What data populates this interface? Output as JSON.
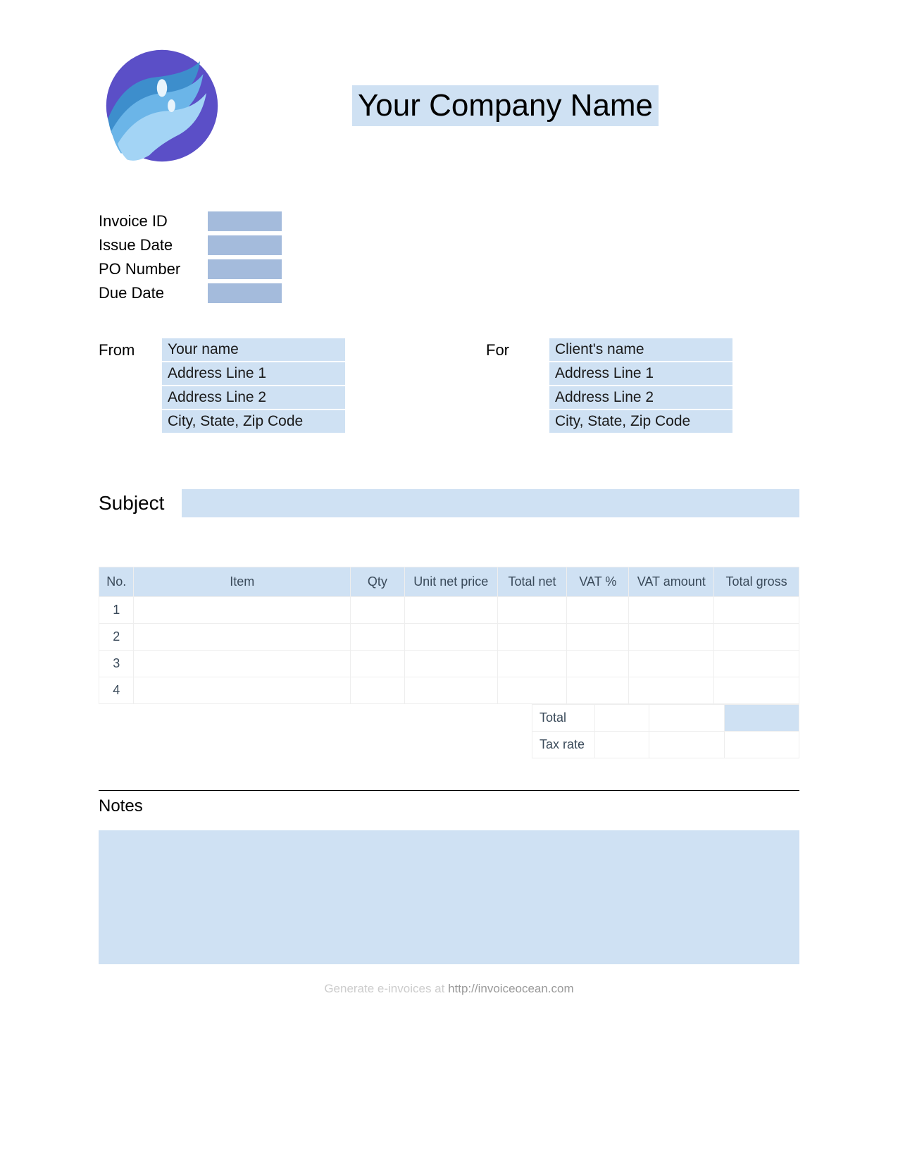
{
  "header": {
    "company_name": "Your Company Name"
  },
  "meta": {
    "invoice_id_label": "Invoice ID",
    "invoice_id": "",
    "issue_date_label": "Issue Date",
    "issue_date": "",
    "po_number_label": "PO Number",
    "po_number": "",
    "due_date_label": "Due Date",
    "due_date": ""
  },
  "from": {
    "label": "From",
    "name": "Your name",
    "address1": "Address Line 1",
    "address2": "Address Line 2",
    "city": "City, State, Zip Code"
  },
  "for": {
    "label": "For",
    "name": "Client's name",
    "address1": "Address Line 1",
    "address2": "Address Line 2",
    "city": "City, State, Zip Code"
  },
  "subject": {
    "label": "Subject",
    "value": ""
  },
  "table": {
    "headers": {
      "no": "No.",
      "item": "Item",
      "qty": "Qty",
      "unit_net_price": "Unit net price",
      "total_net": "Total net",
      "vat_pct": "VAT %",
      "vat_amount": "VAT amount",
      "total_gross": "Total gross"
    },
    "rows": [
      {
        "no": "1",
        "item": "",
        "qty": "",
        "unit_net_price": "",
        "total_net": "",
        "vat_pct": "",
        "vat_amount": "",
        "total_gross": ""
      },
      {
        "no": "2",
        "item": "",
        "qty": "",
        "unit_net_price": "",
        "total_net": "",
        "vat_pct": "",
        "vat_amount": "",
        "total_gross": ""
      },
      {
        "no": "3",
        "item": "",
        "qty": "",
        "unit_net_price": "",
        "total_net": "",
        "vat_pct": "",
        "vat_amount": "",
        "total_gross": ""
      },
      {
        "no": "4",
        "item": "",
        "qty": "",
        "unit_net_price": "",
        "total_net": "",
        "vat_pct": "",
        "vat_amount": "",
        "total_gross": ""
      }
    ],
    "summary": {
      "total_label": "Total",
      "total_vat_pct": "",
      "total_vat_amount": "",
      "total_gross": "",
      "tax_rate_label": "Tax rate",
      "tax_rate_vat_pct": "",
      "tax_rate_vat_amount": "",
      "tax_rate_gross": ""
    }
  },
  "notes": {
    "label": "Notes",
    "value": ""
  },
  "footer": {
    "text": "Generate e-invoices at ",
    "link": "http://invoiceocean.com"
  }
}
